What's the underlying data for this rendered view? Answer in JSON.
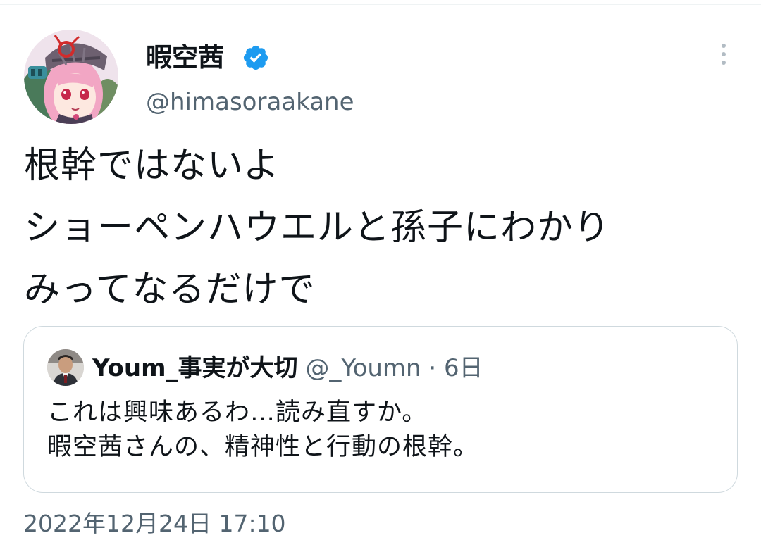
{
  "author": {
    "display_name": "暇空茜",
    "handle": "@himasoraakane",
    "verified_icon": "verified-badge-icon",
    "more_icon": "more-options-icon"
  },
  "tweet": {
    "lines": [
      "根幹ではないよ",
      "ショーペンハウエルと孫子にわかり",
      "みってなるだけで"
    ],
    "timestamp": "2022年12月24日 17:10"
  },
  "quoted_tweet": {
    "display_name": "Youm_事実が大切",
    "handle": "@_Youmn",
    "separator": "·",
    "time": "6日",
    "lines": [
      "これは興味あるわ…読み直すか。",
      "暇空茜さんの、精神性と行動の根幹。"
    ]
  },
  "colors": {
    "accent": "#1d9bf0",
    "secondary_text": "#536471",
    "border": "#cfd9de"
  }
}
